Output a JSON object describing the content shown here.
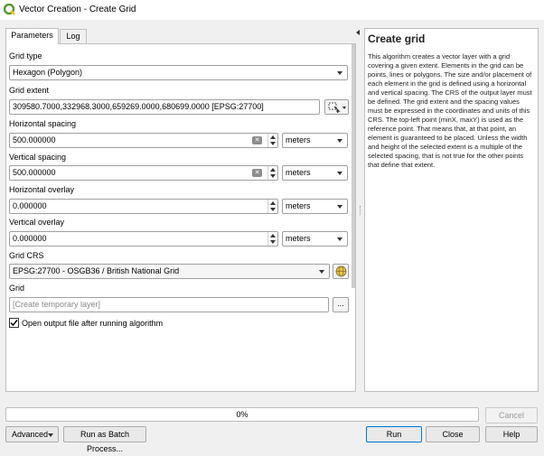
{
  "window": {
    "title": "Vector Creation - Create Grid"
  },
  "tabs": [
    {
      "label": "Parameters"
    },
    {
      "label": "Log"
    }
  ],
  "params": {
    "grid_type": {
      "label": "Grid type",
      "value": "Hexagon (Polygon)"
    },
    "grid_extent": {
      "label": "Grid extent",
      "value": "309580.7000,332968.3000,659269.0000,680699.0000 [EPSG:27700]"
    },
    "horizontal_spacing": {
      "label": "Horizontal spacing",
      "value": "500.000000",
      "unit": "meters"
    },
    "vertical_spacing": {
      "label": "Vertical spacing",
      "value": "500.000000",
      "unit": "meters"
    },
    "horizontal_overlay": {
      "label": "Horizontal overlay",
      "value": "0.000000",
      "unit": "meters"
    },
    "vertical_overlay": {
      "label": "Vertical overlay",
      "value": "0.000000",
      "unit": "meters"
    },
    "grid_crs": {
      "label": "Grid CRS",
      "value": "EPSG:27700 - OSGB36 / British National Grid"
    },
    "grid_output": {
      "label": "Grid",
      "placeholder": "[Create temporary layer]",
      "browse_label": "..."
    },
    "open_output": {
      "label": "Open output file after running algorithm",
      "checked": true
    }
  },
  "help": {
    "title": "Create grid",
    "body": "This algorithm creates a vector layer with a grid covering a given extent. Elements in the grid can be points, lines or polygons. The size and/or placement of each element in the grid is defined using a horizontal and vertical spacing. The CRS of the output layer must be defined. The grid extent and the spacing values must be expressed in the coordinates and units of this CRS. The top-left point (minX, maxY) is used as the reference point. That means that, at that point, an element is guaranteed to be placed. Unless the width and height of the selected extent is a multiple of the selected spacing, that is not true for the other points that define that extent."
  },
  "progress": {
    "value": 0,
    "label": "0%"
  },
  "buttons": {
    "cancel": "Cancel",
    "advanced": "Advanced",
    "batch": "Run as Batch Process...",
    "run": "Run",
    "close": "Close",
    "help": "Help"
  },
  "colors": {
    "accent": "#0078d7",
    "progress_fill": "#06b025",
    "logo": "#589632"
  }
}
